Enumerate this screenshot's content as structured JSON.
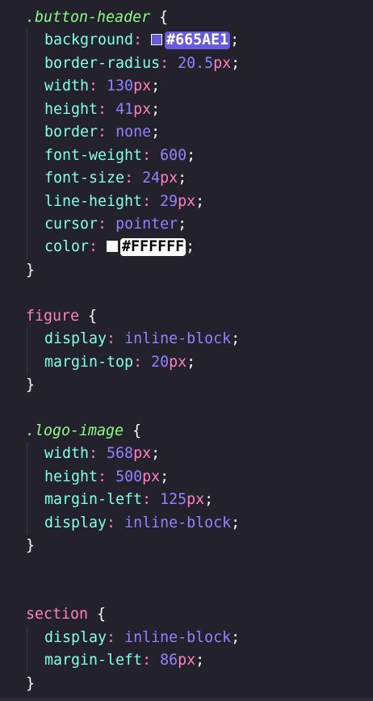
{
  "code": {
    "blocks": [
      {
        "selector": ".button-header",
        "selector_kind": "class",
        "declarations": [
          {
            "property": "background",
            "value_kind": "color",
            "value": "#665AE1"
          },
          {
            "property": "border-radius",
            "value_kind": "number",
            "number": "20.5",
            "unit": "px"
          },
          {
            "property": "width",
            "value_kind": "number",
            "number": "130",
            "unit": "px"
          },
          {
            "property": "height",
            "value_kind": "number",
            "number": "41",
            "unit": "px"
          },
          {
            "property": "border",
            "value_kind": "keyword",
            "value": "none"
          },
          {
            "property": "font-weight",
            "value_kind": "number",
            "number": "600",
            "unit": ""
          },
          {
            "property": "font-size",
            "value_kind": "number",
            "number": "24",
            "unit": "px"
          },
          {
            "property": "line-height",
            "value_kind": "number",
            "number": "29",
            "unit": "px"
          },
          {
            "property": "cursor",
            "value_kind": "keyword",
            "value": "pointer"
          },
          {
            "property": "color",
            "value_kind": "color",
            "value": "#FFFFFF"
          }
        ]
      },
      {
        "selector": "figure",
        "selector_kind": "tag",
        "declarations": [
          {
            "property": "display",
            "value_kind": "keyword",
            "value": "inline-block"
          },
          {
            "property": "margin-top",
            "value_kind": "number",
            "number": "20",
            "unit": "px"
          }
        ]
      },
      {
        "selector": ".logo-image",
        "selector_kind": "class",
        "declarations": [
          {
            "property": "width",
            "value_kind": "number",
            "number": "568",
            "unit": "px"
          },
          {
            "property": "height",
            "value_kind": "number",
            "number": "500",
            "unit": "px"
          },
          {
            "property": "margin-left",
            "value_kind": "number",
            "number": "125",
            "unit": "px"
          },
          {
            "property": "display",
            "value_kind": "keyword",
            "value": "inline-block"
          }
        ]
      },
      {
        "selector": "section",
        "selector_kind": "tag",
        "declarations": [
          {
            "property": "display",
            "value_kind": "keyword",
            "value": "inline-block"
          },
          {
            "property": "margin-left",
            "value_kind": "number",
            "number": "86",
            "unit": "px"
          }
        ]
      }
    ],
    "blank_lines_after_block": [
      1,
      1,
      2,
      0
    ],
    "swatch_colors": {
      "#665AE1": {
        "swatch": "#665AE1",
        "highlight_bg": "#665AE1",
        "highlight_fg": "#ffffff"
      },
      "#FFFFFF": {
        "swatch": "#FFFFFF",
        "highlight_bg": "#FFFFFF",
        "highlight_fg": "#000000"
      }
    }
  },
  "theme": {
    "background": "#22212c",
    "selector_class": "#8aff80",
    "selector_tag": "#ff80bf",
    "property": "#80ffea",
    "value": "#9580ff",
    "unit": "#ff80bf"
  }
}
